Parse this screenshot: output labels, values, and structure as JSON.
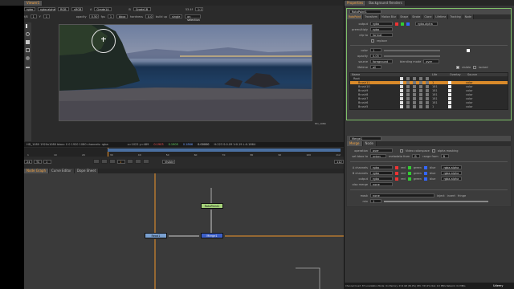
{
  "viewer": {
    "tab_label": "Viewer1",
    "channel": "rgba",
    "layer": "rgba.alpha",
    "colorspace": "RGB",
    "proxy": "sRGB",
    "input_a": "A",
    "input_a_node": "Grade1A",
    "input_b": "B",
    "input_b_node": "Grade1B",
    "zoom": "53.4f",
    "view": "1:1",
    "gain_label": "f/8",
    "gain": "1",
    "y_label": "Y",
    "gamma": "1",
    "opacity_label": "opacity",
    "opacity": "0.50",
    "fps_label": "fps",
    "resolution_value": "1",
    "mode": "bbox",
    "hardness_label": "hardness",
    "hardness": "0.0",
    "build_up_label": "build up",
    "stroke_type": "single",
    "on_selection": "on selection",
    "image_label_bottom": "HD_1080",
    "info_format": "HD_1080 1920x1080  bbox: 0 0 1920 1080 channels: rgba",
    "info_coord": "x=1022 y=489",
    "info_r": "0.1903",
    "info_g": "0.1905",
    "info_b": "0.1866",
    "info_a": "0.00000",
    "info_hsv": "H:223 S:0.09 V:0.19  L:0.1864"
  },
  "timeline": {
    "fps": "24",
    "mode": "TC",
    "frame_start": "1",
    "frame_end": "112",
    "current": "1",
    "ticks": [
      "1",
      "10",
      "20",
      "30",
      "40",
      "50",
      "60",
      "70",
      "80",
      "90",
      "100",
      "112"
    ],
    "playback_mode": "Visible"
  },
  "node_graph": {
    "tabs": [
      "Node Graph",
      "Curve Editor",
      "Dope Sheet"
    ],
    "nodes": {
      "rotopaint": "RotoPaint1",
      "read": "Read1",
      "merge": "Merge1"
    }
  },
  "properties": {
    "tabs": [
      "Properties",
      "Background Renders"
    ],
    "node_name": "RotoPaint1",
    "node_tabs": [
      "RotoPaint",
      "Transform",
      "Motion Blur",
      "Shape",
      "Stroke",
      "Clone",
      "Lifetime",
      "Tracking",
      "Node"
    ],
    "output_label": "output",
    "output_value": "rgba",
    "premultiply_label": "premultiply",
    "premultiply_value": "rgba.alpha",
    "clip_to_label": "clip to",
    "clip_to_value": "format",
    "replace_label": "replace",
    "color_label": "color",
    "color_value": "1",
    "opacity_label": "opacity",
    "opacity_value": "0.05",
    "source_label": "source",
    "source_value": "foreground",
    "blending_label": "blending mode",
    "blending_value": "over",
    "lifetime_label": "lifetime",
    "lifetime_value": "all",
    "visible_label": "visible",
    "locked_label": "locked",
    "table_headers": [
      "Name",
      "",
      "",
      "",
      "",
      "",
      "Life",
      "Overlay",
      "Source"
    ],
    "layers": [
      {
        "name": "Root",
        "life": "",
        "src": ""
      },
      {
        "name": "Brush11",
        "life": "1",
        "src": "color"
      },
      {
        "name": "Brush10",
        "life": "181",
        "src": "color"
      },
      {
        "name": "Brush9",
        "life": "181",
        "src": "color"
      },
      {
        "name": "Brush8",
        "life": "181",
        "src": "color"
      },
      {
        "name": "Brush7",
        "life": "181",
        "src": "color"
      },
      {
        "name": "Brush6",
        "life": "181",
        "src": "color"
      },
      {
        "name": "Brush5",
        "life": "1",
        "src": "color"
      }
    ]
  },
  "merge": {
    "node_name": "Merge1",
    "tabs": [
      "Merge",
      "Node"
    ],
    "operation_label": "operation",
    "operation_value": "over",
    "video_colorspace": "Video colorspace",
    "alpha_masking": "alpha masking",
    "set_bbox_label": "set bbox to",
    "set_bbox_value": "union",
    "metadata_from_label": "metadata from",
    "metadata_from_value": "B",
    "range_from_label": "range from",
    "range_from_value": "B",
    "a_channels_label": "A channels",
    "a_channels_value": "rgba",
    "b_channels_label": "B channels",
    "b_channels_value": "rgba",
    "output_label": "output",
    "output_value": "rgba",
    "also_merge_label": "also merge",
    "also_merge_value": "none",
    "ch_red": "red",
    "ch_green": "green",
    "ch_blue": "blue",
    "ch_alpha": "rgba.alpha",
    "mask_label": "mask",
    "mask_value": "none",
    "inject_label": "inject",
    "invert_label": "invert",
    "fringe_label": "fringe",
    "mix_label": "mix",
    "mix_value": "1"
  },
  "status": {
    "text": "Channel Count: 87 Localization Mode: On Memory: 23.6 GB (36.9%) CPU: 763.2% Disk: 0.0 MB/s Network: 0.0 MB/s",
    "brand": "Udemy"
  },
  "colors": {
    "accent_orange": "#f0962a",
    "node_green": "#a5d27a",
    "node_blue": "#3c5fc8",
    "read_blue": "#7aa0d0",
    "props_highlight": "#d98a2a"
  }
}
